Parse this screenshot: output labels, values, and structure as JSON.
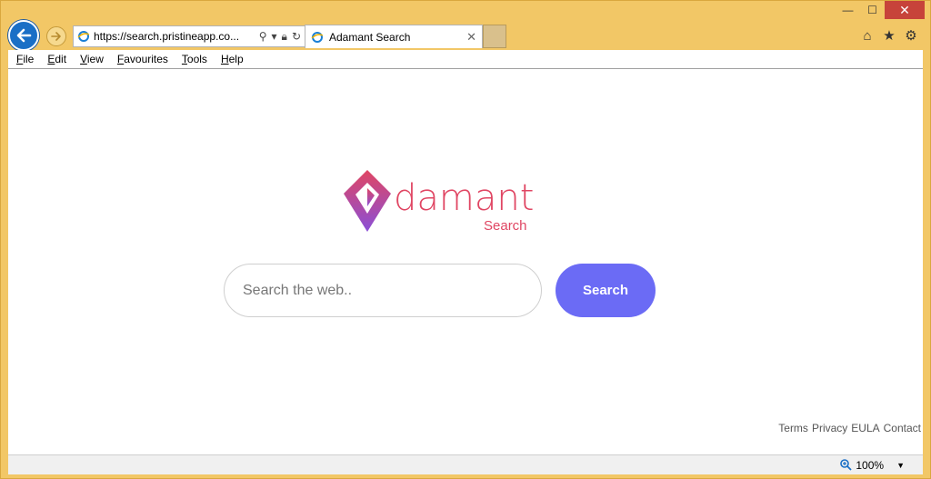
{
  "window": {
    "minimize_glyph": "—",
    "maximize_glyph": "☐",
    "close_glyph": "✕"
  },
  "nav": {
    "url": "https://search.pristineapp.co...",
    "tab_title": "Adamant Search",
    "tab_close": "✕",
    "home_glyph": "⌂",
    "favorites_glyph": "★",
    "tools_glyph": "⚙"
  },
  "menu": {
    "items": [
      "File",
      "Edit",
      "View",
      "Favourites",
      "Tools",
      "Help"
    ]
  },
  "page": {
    "logo_word": "damant",
    "logo_sub": "Search",
    "search_placeholder": "Search the web..",
    "search_button": "Search",
    "footer_links": [
      "Terms",
      "Privacy",
      "EULA",
      "Contact"
    ]
  },
  "status": {
    "zoom": "100%",
    "zoom_caret": "▼"
  },
  "colors": {
    "accent": "#6b6bf5",
    "logo_pink": "#e04663",
    "logo_purple": "#8a4fd8",
    "browser_frame": "#f2c766"
  }
}
